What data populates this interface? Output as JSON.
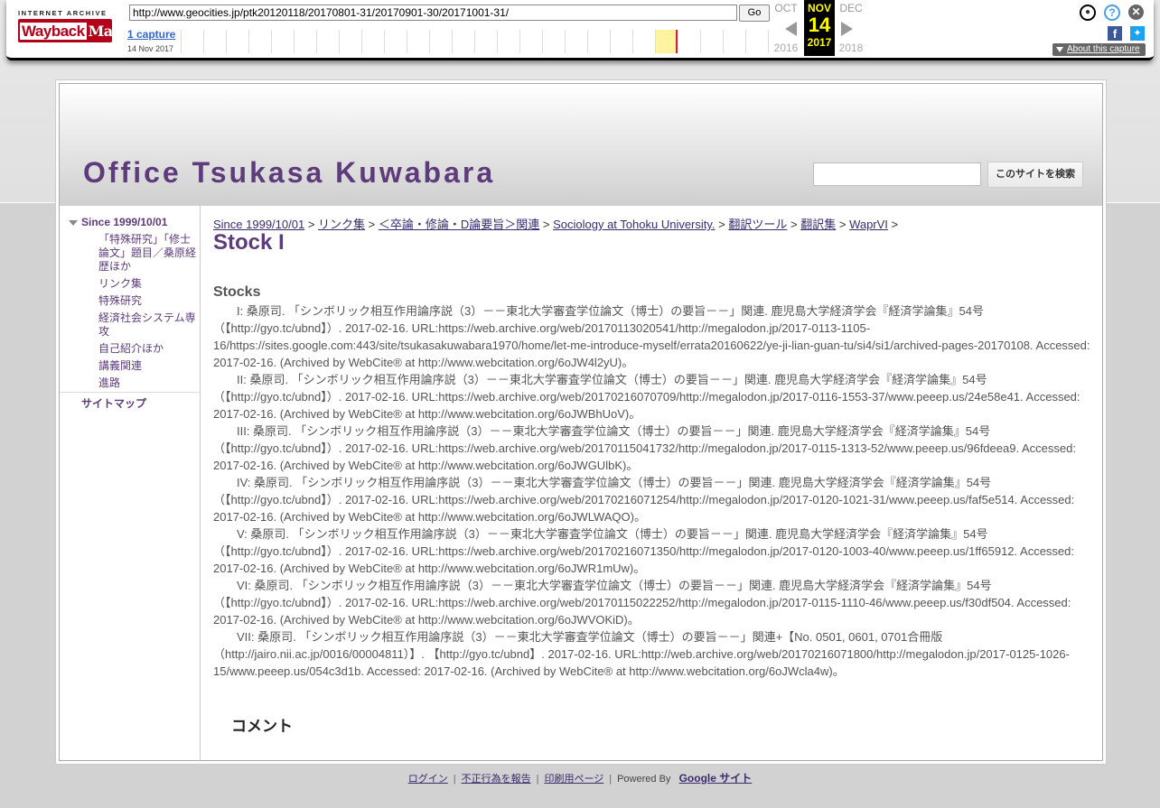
{
  "wayback": {
    "logo_top": "INTERNET ARCHIVE",
    "logo_main": "Wayback",
    "logo_sub": "Machine",
    "url": "http://www.geocities.jp/ptk20120118/20170801-31/20170901-30/20171001-31/",
    "go_label": "Go",
    "captures": "1 capture",
    "capture_date": "14 Nov 2017",
    "prev_month": "OCT",
    "cur_month": "NOV",
    "next_month": "DEC",
    "cur_day": "14",
    "prev_year": "2016",
    "cur_year": "2017",
    "next_year": "2018",
    "about": "About this capture"
  },
  "site": {
    "title": "Office Tsukasa Kuwabara",
    "search_button": "このサイトを検索"
  },
  "sidebar": {
    "home": "Since 1999/10/01",
    "items": [
      {
        "label": "「特殊研究」「修士論文」題目／桑原経歴ほか"
      },
      {
        "label": "リンク集"
      },
      {
        "label": "特殊研究"
      },
      {
        "label": "経済社会システム専攻"
      },
      {
        "label": "自己紹介ほか"
      },
      {
        "label": "講義関連"
      },
      {
        "label": "進路"
      }
    ],
    "sitemap": "サイトマップ"
  },
  "breadcrumb": [
    {
      "label": "Since 1999/10/01"
    },
    {
      "label": "リンク集"
    },
    {
      "label": "＜卒論・修論・D論要旨＞関連"
    },
    {
      "label": "Sociology at Tohoku University."
    },
    {
      "label": "翻訳ツール"
    },
    {
      "label": "翻訳集"
    },
    {
      "label": "WaprVI"
    }
  ],
  "page_title": "Stock I",
  "stocks_heading": "Stocks",
  "entries": [
    {
      "text": "I: 桑原司. 「シンボリック相互作用論序説（3）－－東北大学審査学位論文（博士）の要旨－－」関連. 鹿児島大学経済学会『経済学論集』54号（【http://gyo.tc/ubnd】）. 2017-02-16. URL:https://web.archive.org/web/20170113020541/http://megalodon.jp/2017-0113-1105-16/https://sites.google.com:443/site/tsukasakuwabara1970/home/let-me-introduce-myself/errata20160622/ye-ji-lian-guan-tu/si4/si1/archived-pages-20170108. Accessed: 2017-02-16. (Archived by WebCite® at http://www.webcitation.org/6oJW4l2yU)。"
    },
    {
      "text": "II: 桑原司. 「シンボリック相互作用論序説（3）－－東北大学審査学位論文（博士）の要旨－－」関連. 鹿児島大学経済学会『経済学論集』54号（【http://gyo.tc/ubnd】）. 2017-02-16. URL:https://web.archive.org/web/20170216070709/http://megalodon.jp/2017-0116-1553-37/www.peeep.us/24e58e41. Accessed: 2017-02-16. (Archived by WebCite® at http://www.webcitation.org/6oJWBhUoV)。"
    },
    {
      "text": "III: 桑原司. 「シンボリック相互作用論序説（3）－－東北大学審査学位論文（博士）の要旨－－」関連. 鹿児島大学経済学会『経済学論集』54号（【http://gyo.tc/ubnd】）. 2017-02-16. URL:https://web.archive.org/web/20170115041732/http://megalodon.jp/2017-0115-1313-52/www.peeep.us/96fdeea9. Accessed: 2017-02-16. (Archived by WebCite® at http://www.webcitation.org/6oJWGUlbK)。"
    },
    {
      "text": "IV: 桑原司. 「シンボリック相互作用論序説（3）－－東北大学審査学位論文（博士）の要旨－－」関連. 鹿児島大学経済学会『経済学論集』54号（【http://gyo.tc/ubnd】）. 2017-02-16. URL:https://web.archive.org/web/20170216071254/http://megalodon.jp/2017-0120-1021-31/www.peeep.us/faf5e514. Accessed: 2017-02-16. (Archived by WebCite® at http://www.webcitation.org/6oJWLWAQO)。"
    },
    {
      "text": "V: 桑原司. 「シンボリック相互作用論序説（3）－－東北大学審査学位論文（博士）の要旨－－」関連. 鹿児島大学経済学会『経済学論集』54号（【http://gyo.tc/ubnd】）. 2017-02-16. URL:https://web.archive.org/web/20170216071350/http://megalodon.jp/2017-0120-1003-40/www.peeep.us/1ff65912. Accessed: 2017-02-16. (Archived by WebCite® at http://www.webcitation.org/6oJWR1mUw)。"
    },
    {
      "text": "VI: 桑原司. 「シンボリック相互作用論序説（3）－－東北大学審査学位論文（博士）の要旨－－」関連. 鹿児島大学経済学会『経済学論集』54号（【http://gyo.tc/ubnd】）. 2017-02-16. URL:https://web.archive.org/web/20170115022252/http://megalodon.jp/2017-0115-1110-46/www.peeep.us/f30df504. Accessed: 2017-02-16. (Archived by WebCite® at http://www.webcitation.org/6oJWVOKiD)。"
    },
    {
      "text": "VII: 桑原司. 「シンボリック相互作用論序説（3）－－東北大学審査学位論文（博士）の要旨－－」関連+【No. 0501, 0601, 0701合冊版（http://jairo.nii.ac.jp/0016/00004811）】. 【http://gyo.tc/ubnd】. 2017-02-16. URL:http://web.archive.org/web/20170216071800/http://megalodon.jp/2017-0125-1026-15/www.peeep.us/054c3d1b. Accessed: 2017-02-16. (Archived by WebCite® at http://www.webcitation.org/6oJWcla4w)。"
    }
  ],
  "comment_heading": "コメント",
  "footer": {
    "login": "ログイン",
    "report": "不正行為を報告",
    "print": "印刷用ページ",
    "powered": "Powered By",
    "google_sites": "Google サイト"
  },
  "colors": {
    "accent": "#5e3b7a",
    "wayback_red": "#b3001b",
    "cur_date_yellow": "#ffff00"
  }
}
